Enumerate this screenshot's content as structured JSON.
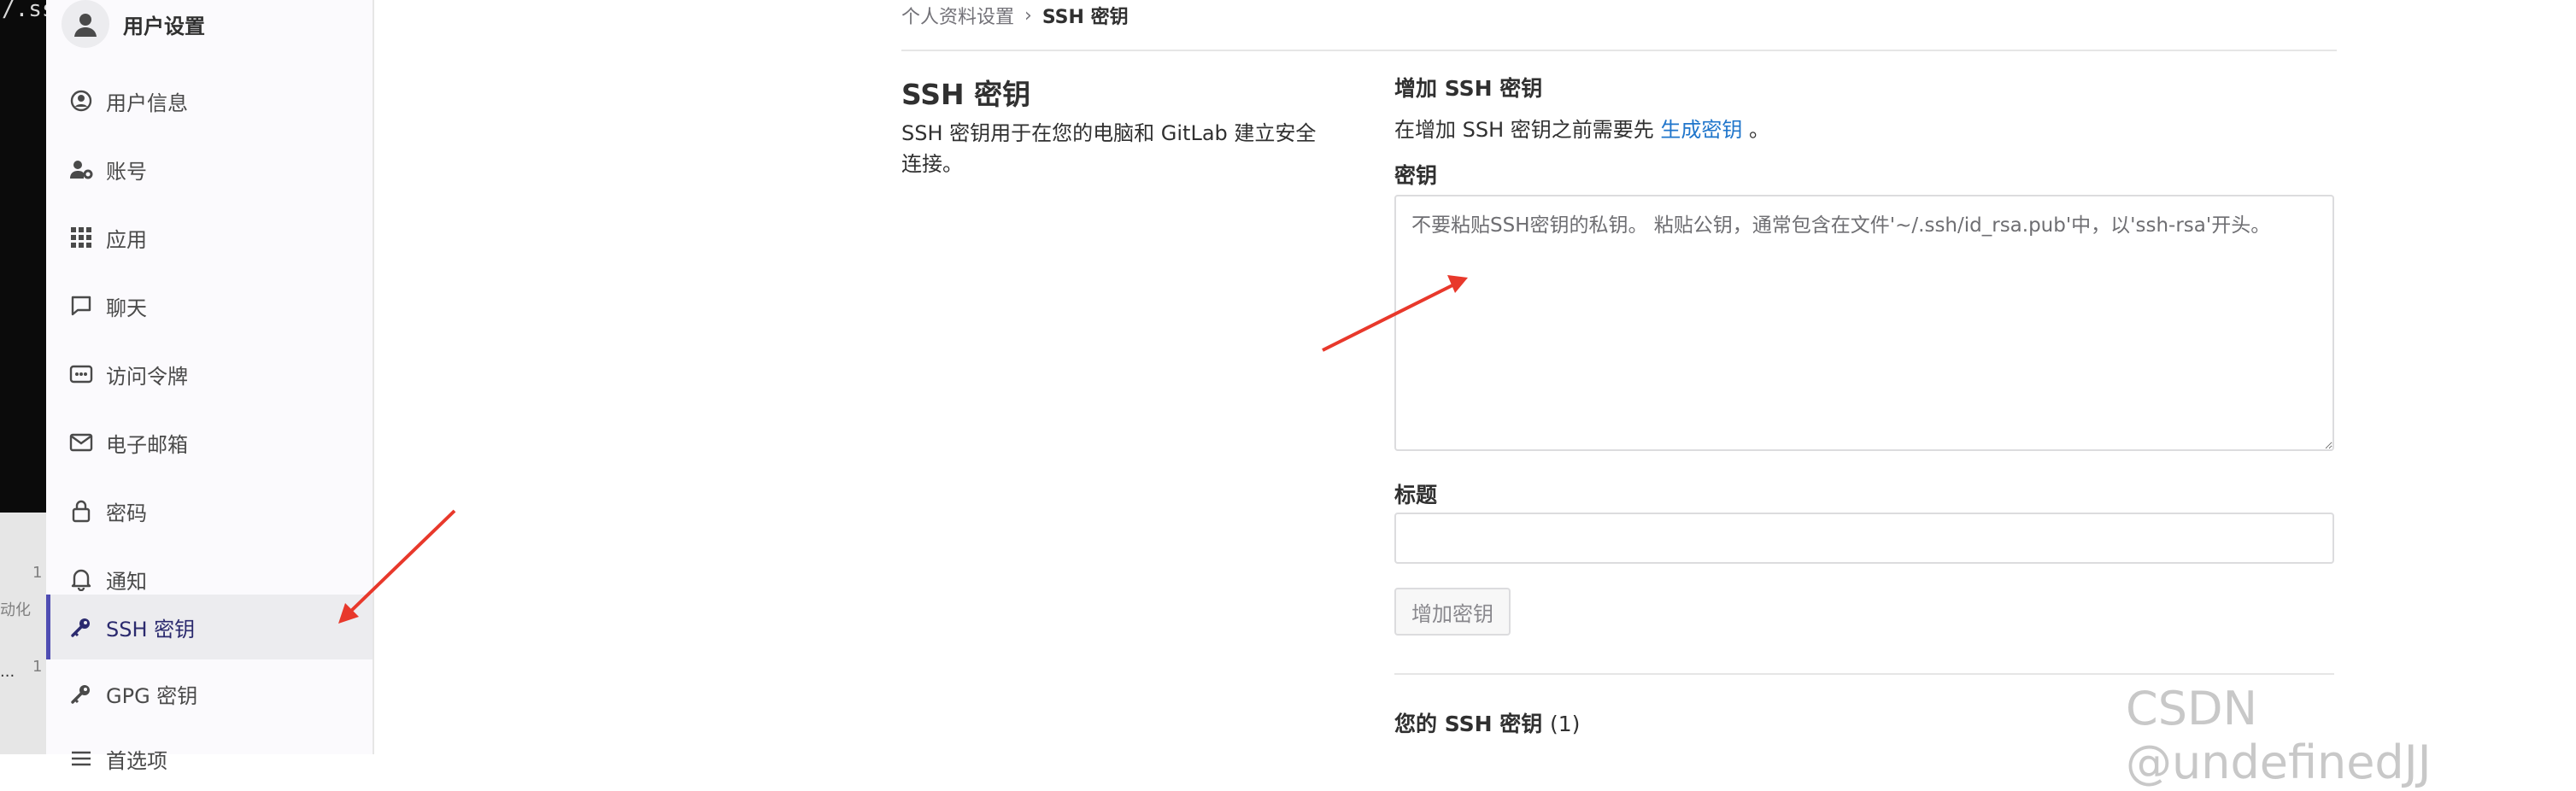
{
  "terminal": {
    "top_text": "/.ss",
    "bottom_lines": [
      "1",
      "动化",
      "1",
      "..."
    ]
  },
  "sidebar": {
    "title": "用户设置",
    "items": [
      {
        "label": "用户信息",
        "icon": "profile-icon"
      },
      {
        "label": "账号",
        "icon": "account-icon"
      },
      {
        "label": "应用",
        "icon": "applications-icon"
      },
      {
        "label": "聊天",
        "icon": "chat-icon"
      },
      {
        "label": "访问令牌",
        "icon": "token-icon"
      },
      {
        "label": "电子邮箱",
        "icon": "mail-icon"
      },
      {
        "label": "密码",
        "icon": "lock-icon"
      },
      {
        "label": "通知",
        "icon": "bell-icon"
      },
      {
        "label": "SSH 密钥",
        "icon": "key-icon",
        "active": true
      },
      {
        "label": "GPG 密钥",
        "icon": "key-icon"
      },
      {
        "label": "首选项",
        "icon": "preferences-icon"
      }
    ]
  },
  "breadcrumb": {
    "parent": "个人资料设置",
    "current": "SSH 密钥"
  },
  "section": {
    "title": "SSH 密钥",
    "description": "SSH 密钥用于在您的电脑和 GitLab 建立安全连接。"
  },
  "form": {
    "heading": "增加 SSH 密钥",
    "hint_prefix": "在增加 SSH 密钥之前需要先 ",
    "hint_link": "生成密钥",
    "hint_suffix": " 。",
    "key_label": "密钥",
    "key_placeholder": "不要粘贴SSH密钥的私钥。 粘贴公钥，通常包含在文件'~/.ssh/id_rsa.pub'中，以'ssh-rsa'开头。",
    "title_label": "标题",
    "title_value": "",
    "submit_label": "增加密钥"
  },
  "your_keys": {
    "label": "您的 SSH 密钥",
    "count": "(1)"
  },
  "watermark": "CSDN @undefinedJJ",
  "colors": {
    "accent": "#4f4db3",
    "link": "#1f75cb",
    "annotation": "#e8382b"
  }
}
